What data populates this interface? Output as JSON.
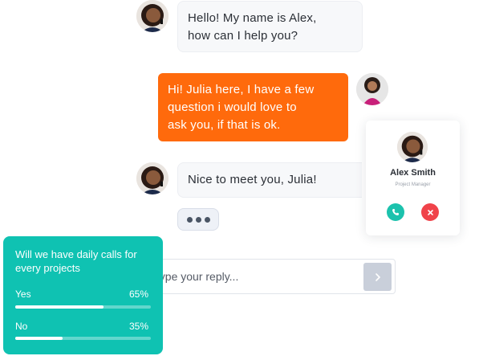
{
  "messages": [
    {
      "sender": "alex",
      "text": "Hello! My name is Alex,\nhow can I help you?"
    },
    {
      "sender": "julia",
      "text": "Hi! Julia here, I have a few\nquestion i would love to\nask you, if that is ok."
    },
    {
      "sender": "alex",
      "text": "Nice to meet you, Julia!"
    }
  ],
  "typing_indicator": {
    "icon": "ellipsis-icon"
  },
  "reply": {
    "placeholder": "Type your reply...",
    "send_icon": "chevron-right-icon"
  },
  "contact_card": {
    "name": "Alex Smith",
    "role": "Project Manager",
    "accept_icon": "phone-icon",
    "decline_icon": "close-icon"
  },
  "poll": {
    "question": "Will we have daily calls for every projects",
    "options": [
      {
        "label": "Yes",
        "percent_label": "65%",
        "fraction": 0.65
      },
      {
        "label": "No",
        "percent_label": "35%",
        "fraction": 0.35
      }
    ]
  },
  "colors": {
    "outgoing_bubble": "#ff6a0c",
    "poll_background": "#0fc2b2",
    "accept_call": "#1cc2ad",
    "decline_call": "#f0434a"
  }
}
